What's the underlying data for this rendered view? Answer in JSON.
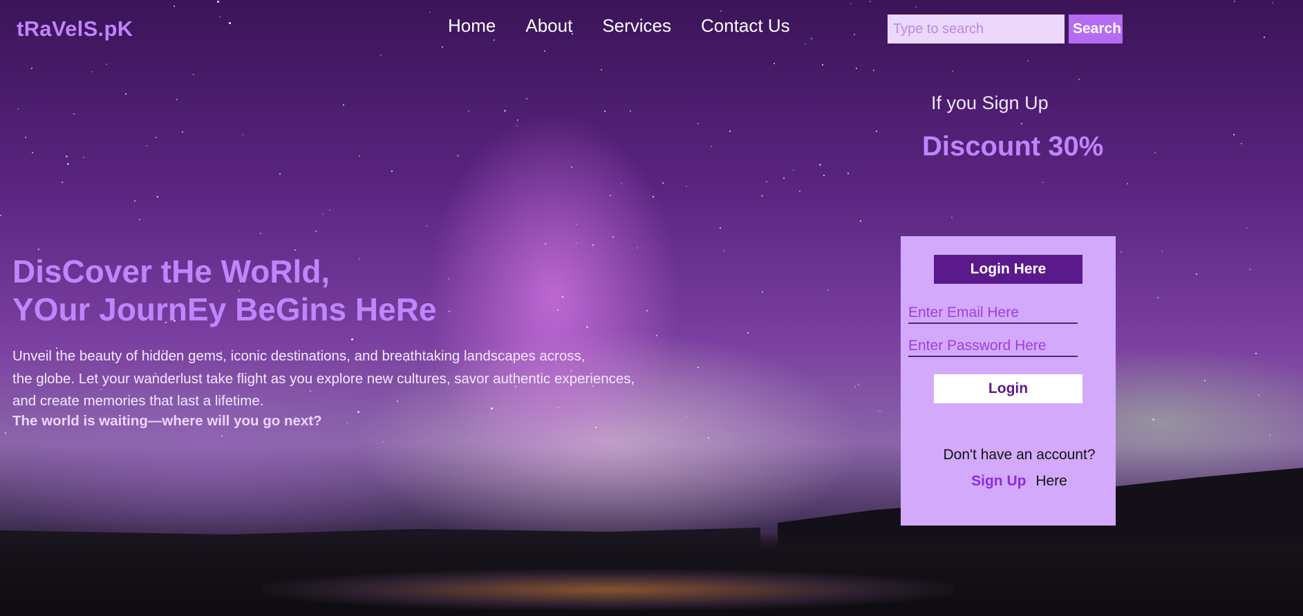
{
  "brand": {
    "logo": "tRaVelS.pK"
  },
  "nav": {
    "items": [
      {
        "label": "Home"
      },
      {
        "label": "About"
      },
      {
        "label": "Services"
      },
      {
        "label": "Contact Us"
      }
    ]
  },
  "search": {
    "placeholder": "Type to search",
    "button_label": "Search"
  },
  "promo": {
    "subtitle": "If you Sign Up",
    "headline": "Discount 30%"
  },
  "hero": {
    "title_line1": "DisCover tHe WoRld,",
    "title_line2": "YOur JournEy BeGins HeRe",
    "text_line1": "Unveil the beauty of hidden gems, iconic destinations, and breathtaking landscapes across,",
    "text_line2": "the globe. Let your wanderlust take flight as you explore new cultures, savor authentic experiences,",
    "text_line3": "and create memories that last a lifetime.",
    "cta": "The world is waiting—where will you go next?"
  },
  "login": {
    "title": "Login Here",
    "email_placeholder": "Enter Email Here",
    "password_placeholder": "Enter Password Here",
    "button_label": "Login",
    "no_account": "Don't have an account?",
    "signup_link": "Sign Up",
    "signup_suffix": "Here"
  },
  "colors": {
    "accent": "#c084fc",
    "card": "#d3aafb",
    "dark_purple": "#5b1a8b",
    "search_button": "#b46cf2"
  }
}
